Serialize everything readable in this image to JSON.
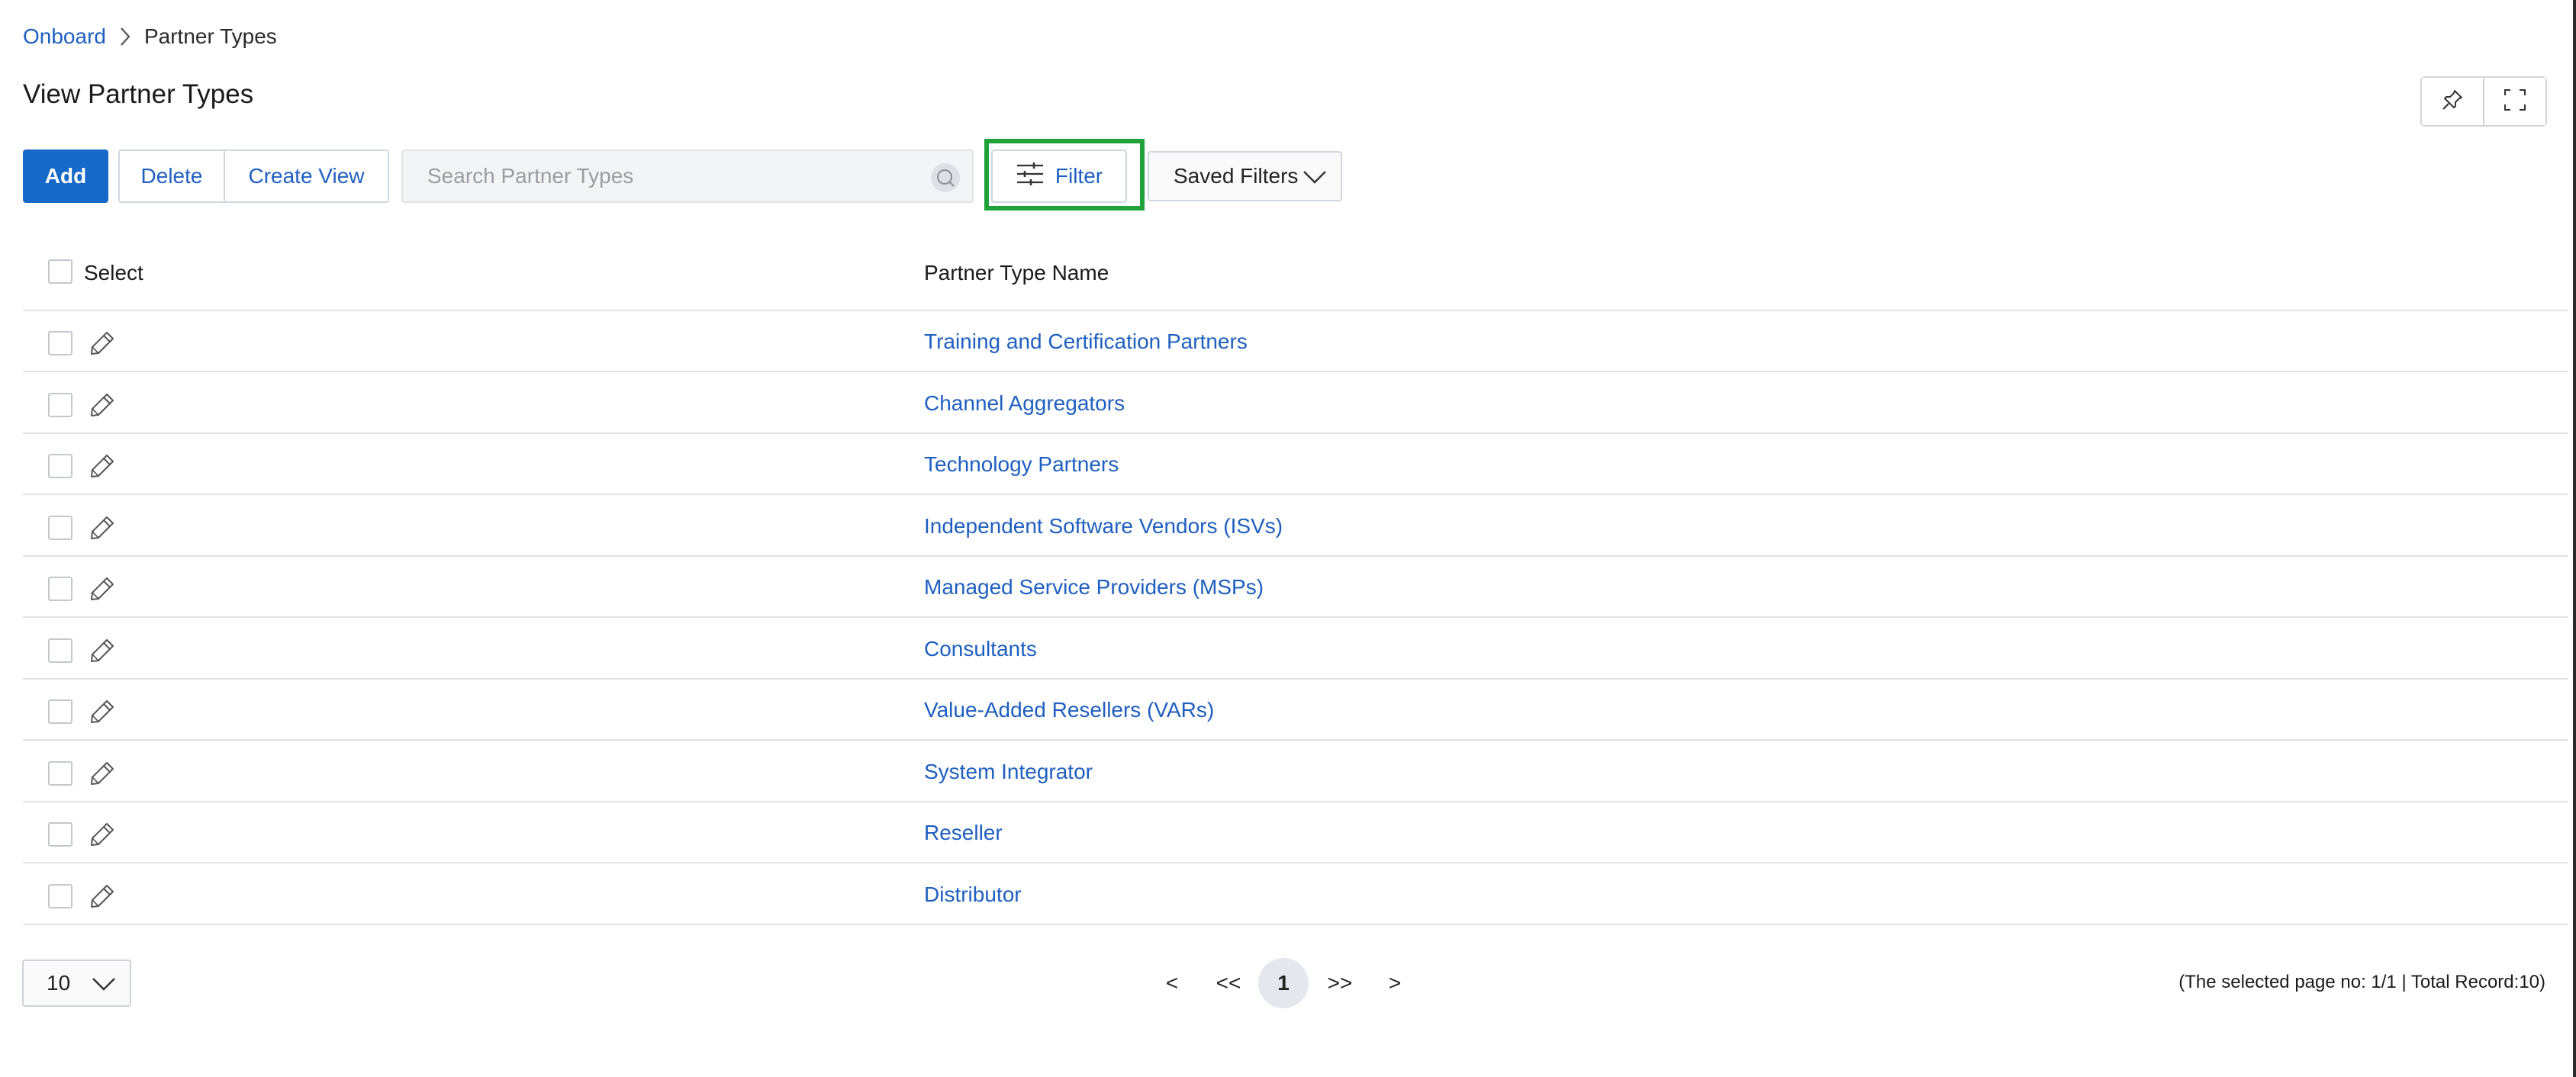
{
  "breadcrumb": {
    "root": "Onboard",
    "current": "Partner Types"
  },
  "page_title": "View Partner Types",
  "toolbar": {
    "add_label": "Add",
    "delete_label": "Delete",
    "create_view_label": "Create View",
    "search_placeholder": "Search Partner Types",
    "filter_label": "Filter",
    "saved_filters_label": "Saved Filters"
  },
  "table": {
    "select_header": "Select",
    "name_header": "Partner Type Name",
    "rows": [
      "Training and Certification Partners",
      "Channel Aggregators",
      "Technology Partners",
      "Independent Software Vendors (ISVs)",
      "Managed Service Providers (MSPs)",
      "Consultants",
      "Value-Added Resellers (VARs)",
      "System Integrator",
      "Reseller",
      "Distributor"
    ]
  },
  "pagination": {
    "page_size": "10",
    "prev": "<",
    "first": "<<",
    "current": "1",
    "last": ">>",
    "next": ">",
    "record_info": "(The selected page no: 1/1 | Total Record:10)"
  },
  "icons": {
    "pin": "pin-icon",
    "fullscreen": "fullscreen-icon",
    "search": "search-icon",
    "filter": "sliders-icon",
    "edit": "pencil-icon",
    "dropdown": "chevron-down-icon",
    "breadcrumb_separator": "chevron-right-icon"
  },
  "colors": {
    "primary": "#1769c8",
    "link": "#1f5fbf",
    "highlight": "#1fa23a"
  }
}
